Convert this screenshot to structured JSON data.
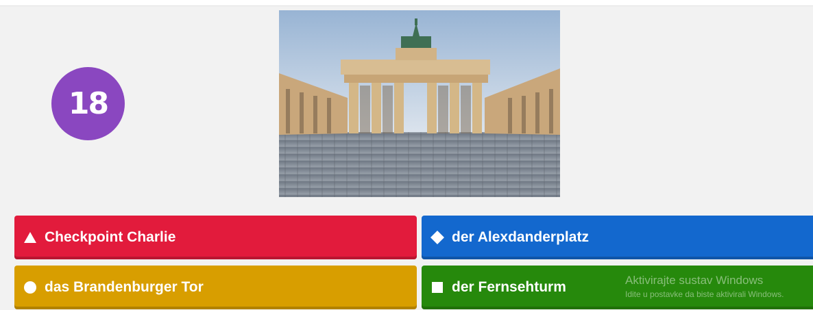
{
  "timer": {
    "value": "18"
  },
  "image": {
    "subject_icon": "brandenburg-gate-photo"
  },
  "answers": [
    {
      "shape": "triangle-icon",
      "label": "Checkpoint Charlie",
      "color": "#e21b3c"
    },
    {
      "shape": "diamond-icon",
      "label": "der Alexdanderplatz",
      "color": "#1368ce"
    },
    {
      "shape": "circle-icon",
      "label": "das Brandenburger Tor",
      "color": "#d89e00"
    },
    {
      "shape": "square-icon",
      "label": "der Fernsehturm",
      "color": "#26890c"
    }
  ],
  "watermark": {
    "title": "Aktivirajte sustav Windows",
    "subtitle": "Idite u postavke da biste aktivirali Windows."
  }
}
